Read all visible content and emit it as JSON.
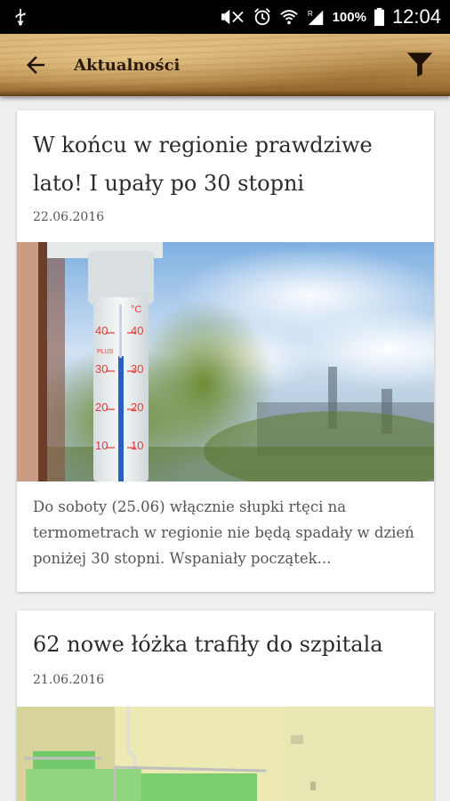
{
  "status_bar": {
    "battery": "100%",
    "time": "12:04",
    "icons": [
      "usb-icon",
      "mute-icon",
      "alarm-icon",
      "wifi-icon",
      "signal-icon",
      "battery-icon"
    ]
  },
  "app_bar": {
    "title": "Aktualności",
    "back_icon": "arrow-back-icon",
    "filter_icon": "filter-icon"
  },
  "articles": [
    {
      "title": "W końcu w regionie prawdziwe lato! I upały po 30 stopni",
      "date": "22.06.2016",
      "image": "thermometer-photo",
      "thermometer_scale": [
        "40",
        "30",
        "20",
        "10"
      ],
      "thermometer_unit": "°C",
      "thermometer_brand": "PLUS",
      "excerpt": "Do soboty (25.06) włącznie słupki rtęci na termometrach w regionie nie będą spadały w dzień poniżej 30 stopni. Wspaniały początek..."
    },
    {
      "title": "62 nowe łóżka trafiły do szpitala",
      "date": "21.06.2016",
      "image": "hospital-beds-photo"
    }
  ]
}
